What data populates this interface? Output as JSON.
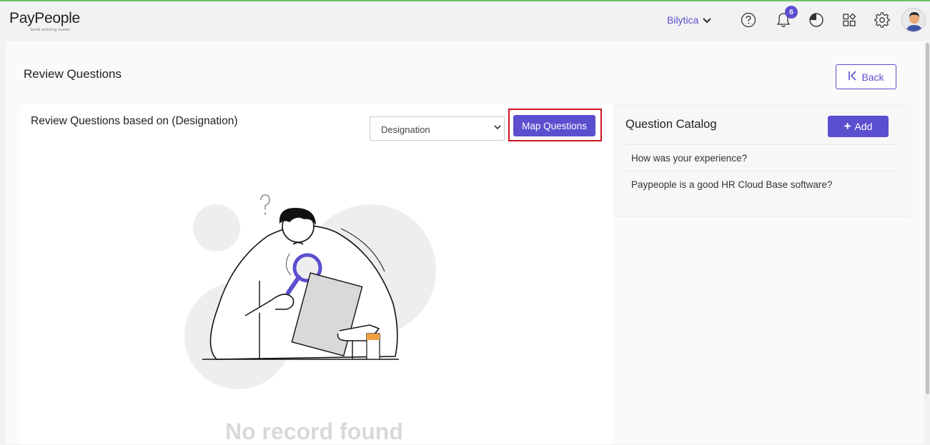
{
  "app": {
    "logo_text": "PayPeople",
    "logo_tagline": "build winning teams"
  },
  "header": {
    "company_name": "Bilytica",
    "notification_count": "6",
    "icons": [
      "help-icon",
      "bell-icon",
      "pie-clock-icon",
      "apps-grid-icon",
      "gear-icon",
      "avatar"
    ]
  },
  "page": {
    "title": "Review Questions",
    "back_label": "Back"
  },
  "left_panel": {
    "title": "Review Questions based on (Designation)",
    "select_value": "Designation",
    "map_button_label": "Map Questions",
    "empty_text": "No record found"
  },
  "catalog": {
    "title": "Question Catalog",
    "add_label": "Add",
    "questions": [
      "How was your experience?",
      "Paypeople is a good HR Cloud Base software?"
    ]
  },
  "colors": {
    "accent": "#5b4fcf",
    "highlight": "#d0131d"
  }
}
